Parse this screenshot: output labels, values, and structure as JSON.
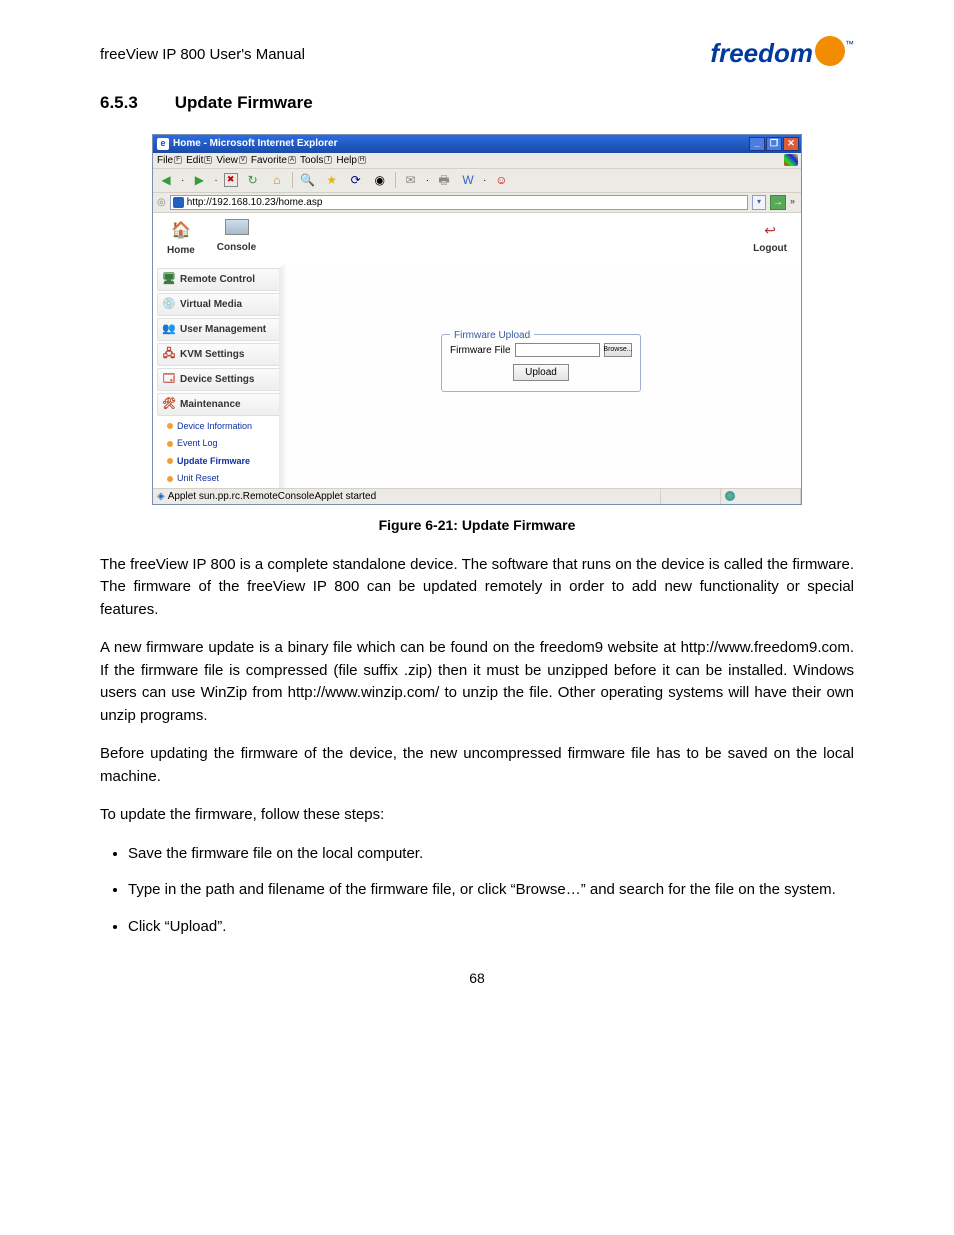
{
  "doc": {
    "header": "freeView IP 800 User's Manual",
    "logo_text": "freedom",
    "section_number": "6.5.3",
    "section_title": "Update Firmware",
    "figure_caption": "Figure 6-21: Update Firmware",
    "para1": "The freeView IP 800 is a complete standalone device. The software that runs on the device is called the firmware. The firmware of the freeView IP 800 can be updated remotely in order to add new functionality or special features.",
    "para2": "A new firmware update is a binary file which can be found on the freedom9 website at http://www.freedom9.com. If the firmware file is compressed (file suffix .zip) then it must be unzipped before it can be installed. Windows users can use WinZip from http://www.winzip.com/ to unzip the file. Other operating systems will have their own unzip programs.",
    "para3": "Before updating the firmware of the device, the new uncompressed firmware file has to be saved on the local machine.",
    "para4": "To update the firmware, follow these steps:",
    "steps": [
      "Save the firmware file on the local computer.",
      "Type in the path and filename of the firmware file, or click “Browse…” and search for the file on the system.",
      "Click “Upload”."
    ],
    "page_number": "68"
  },
  "browser": {
    "title": "Home - Microsoft Internet Explorer",
    "menus": {
      "file": "File",
      "edit": "Edit",
      "view": "View",
      "favorite": "Favorite",
      "tools": "Tools",
      "help": "Help"
    },
    "hotkeys": {
      "file": "F",
      "edit": "E",
      "view": "V",
      "favorite": "A",
      "tools": "T",
      "help": "H"
    },
    "address": "http://192.168.10.23/home.asp",
    "status": "Applet sun.pp.rc.RemoteConsoleApplet started"
  },
  "webapp": {
    "home": "Home",
    "console": "Console",
    "logout": "Logout",
    "sidebar": {
      "remote_control": "Remote Control",
      "virtual_media": "Virtual Media",
      "user_management": "User Management",
      "kvm_settings": "KVM Settings",
      "device_settings": "Device Settings",
      "maintenance": "Maintenance",
      "sub_device_info": "Device Information",
      "sub_event_log": "Event Log",
      "sub_update_fw": "Update Firmware",
      "sub_unit_reset": "Unit Reset"
    },
    "fieldset_title": "Firmware Upload",
    "fw_file_label": "Firmware File",
    "browse_label": "Browse...",
    "upload_label": "Upload"
  }
}
